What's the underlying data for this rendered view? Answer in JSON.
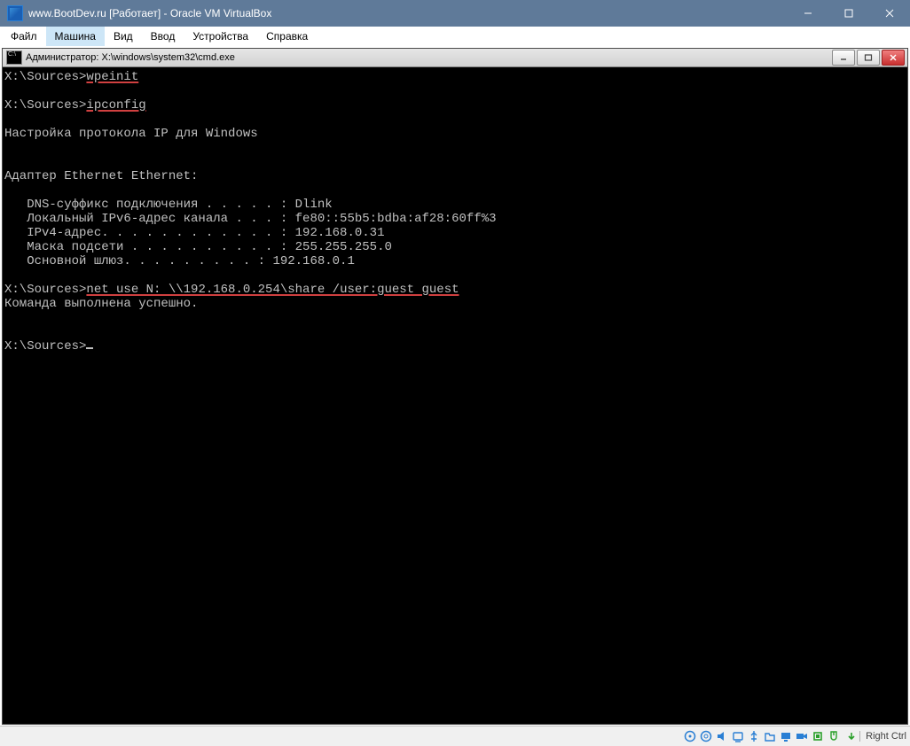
{
  "outer_window": {
    "title": "www.BootDev.ru [Работает] - Oracle VM VirtualBox",
    "controls": {
      "minimize": "minimize",
      "maximize": "maximize",
      "close": "close"
    }
  },
  "menubar": {
    "items": [
      "Файл",
      "Машина",
      "Вид",
      "Ввод",
      "Устройства",
      "Справка"
    ],
    "active_index": 1
  },
  "cmd_window": {
    "title": "Администратор: X:\\windows\\system32\\cmd.exe",
    "controls": {
      "minimize": "minimize",
      "maximize": "maximize",
      "close": "close"
    }
  },
  "console": {
    "prompt": "X:\\Sources>",
    "cmd1": "wpeinit",
    "cmd2": "ipconfig",
    "line_blank": "",
    "cfg_header": "Настройка протокола IP для Windows",
    "adapter": "Адаптер Ethernet Ethernet:",
    "dns": "   DNS-суффикс подключения . . . . . : Dlink",
    "ipv6": "   Локальный IPv6-адрес канала . . . : fe80::55b5:bdba:af28:60ff%3",
    "ipv4": "   IPv4-адрес. . . . . . . . . . . . : 192.168.0.31",
    "mask": "   Маска подсети . . . . . . . . . . : 255.255.255.0",
    "gw": "   Основной шлюз. . . . . . . . . : 192.168.0.1",
    "cmd3": "net use N: \\\\192.168.0.254\\share /user:guest guest",
    "cmd3_result": "Команда выполнена успешно."
  },
  "statusbar": {
    "hostkey_label": "Right Ctrl"
  }
}
